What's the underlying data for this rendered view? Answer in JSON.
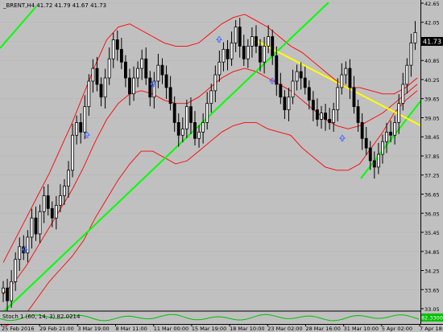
{
  "window": {
    "title": "_BRENT,H4  41.72 41.79 41.67 41.73",
    "current_price": "41.73"
  },
  "indicator": {
    "label": "Stoch 1 (60, 14, 3) 82.0214",
    "current_value": "82.3300",
    "level_color": "#00c000"
  },
  "colors": {
    "background": "#c0c0c0",
    "candle": "#000000",
    "bollinger": "#ff0000",
    "trendline_main": "#00ff00",
    "trendline_resistance": "#ffff00",
    "axis_text": "#000000",
    "arrows": "#4a6cff"
  },
  "chart_data": {
    "type": "candlestick",
    "symbol": "_BRENT",
    "timeframe": "H4",
    "yaxis": {
      "min": 33.0,
      "max": 42.75,
      "ticks": [
        "42.65",
        "42.05",
        "41.45",
        "40.85",
        "40.25",
        "39.65",
        "39.05",
        "38.45",
        "37.85",
        "37.25",
        "36.65",
        "36.05",
        "35.45",
        "34.85",
        "34.25",
        "33.65",
        "33.05"
      ]
    },
    "xaxis": {
      "ticks": [
        "25 Feb 2016",
        "29 Feb 21:00",
        "3 Mar 19:00",
        "8 Mar 11:00",
        "11 Mar 00:00",
        "15 Mar 19:00",
        "18 Mar 10:00",
        "23 Mar 02:00",
        "28 Mar 16:00",
        "31 Mar 10:00",
        "5 Apr 02:00",
        "7 Apr 18:00"
      ]
    },
    "closes": [
      33.7,
      33.3,
      33.9,
      34.6,
      35.0,
      34.8,
      35.3,
      35.9,
      35.4,
      36.1,
      36.6,
      36.2,
      35.9,
      36.3,
      36.6,
      36.9,
      37.4,
      38.5,
      38.9,
      38.6,
      39.4,
      40.2,
      40.6,
      40.1,
      39.7,
      40.3,
      40.9,
      41.5,
      41.2,
      40.8,
      40.3,
      39.8,
      40.3,
      40.6,
      40.9,
      40.3,
      39.7,
      40.2,
      40.7,
      40.4,
      40.0,
      39.5,
      38.9,
      38.5,
      38.7,
      39.4,
      38.9,
      38.4,
      38.6,
      38.9,
      39.5,
      39.9,
      40.4,
      40.8,
      41.2,
      40.9,
      41.4,
      41.9,
      41.3,
      40.9,
      41.3,
      41.6,
      41.3,
      40.8,
      41.3,
      41.6,
      41.0,
      40.1,
      39.7,
      39.3,
      39.7,
      40.2,
      40.5,
      40.3,
      40.0,
      39.6,
      39.3,
      39.0,
      39.2,
      39.0,
      38.9,
      39.3,
      40.0,
      40.4,
      40.6,
      40.0,
      39.4,
      38.9,
      38.4,
      38.1,
      37.7,
      37.5,
      37.9,
      38.3,
      38.6,
      38.5,
      38.9,
      39.5,
      40.1,
      40.7,
      41.4,
      41.73
    ],
    "bollinger_upper": [
      34.5,
      35.2,
      35.9,
      36.6,
      37.3,
      38.1,
      38.9,
      39.8,
      40.7,
      41.5,
      41.9,
      42.0,
      41.8,
      41.6,
      41.4,
      41.3,
      41.3,
      41.4,
      41.7,
      42.0,
      42.2,
      42.3,
      42.1,
      41.9,
      41.6,
      41.3,
      41.1,
      40.8,
      40.5,
      40.2,
      40.0,
      40.0,
      39.9,
      39.8,
      39.8,
      40.0,
      40.3
    ],
    "bollinger_middle": [
      33.5,
      33.9,
      34.4,
      35.0,
      35.6,
      36.2,
      36.8,
      37.5,
      38.3,
      39.0,
      39.5,
      39.8,
      39.9,
      39.8,
      39.6,
      39.5,
      39.5,
      39.7,
      40.0,
      40.3,
      40.5,
      40.6,
      40.5,
      40.3,
      40.1,
      39.9,
      39.6,
      39.3,
      39.0,
      38.8,
      38.7,
      38.8,
      39.0,
      39.2,
      39.5,
      39.8,
      40.1
    ],
    "bollinger_lower": [
      32.5,
      32.6,
      32.9,
      33.4,
      33.9,
      34.3,
      34.7,
      35.2,
      35.9,
      36.5,
      37.1,
      37.6,
      38.0,
      38.0,
      37.8,
      37.6,
      37.7,
      38.0,
      38.3,
      38.6,
      38.8,
      38.9,
      38.9,
      38.7,
      38.6,
      38.5,
      38.1,
      37.8,
      37.5,
      37.4,
      37.4,
      37.6,
      38.1,
      38.6,
      39.2,
      39.6,
      39.9
    ]
  }
}
